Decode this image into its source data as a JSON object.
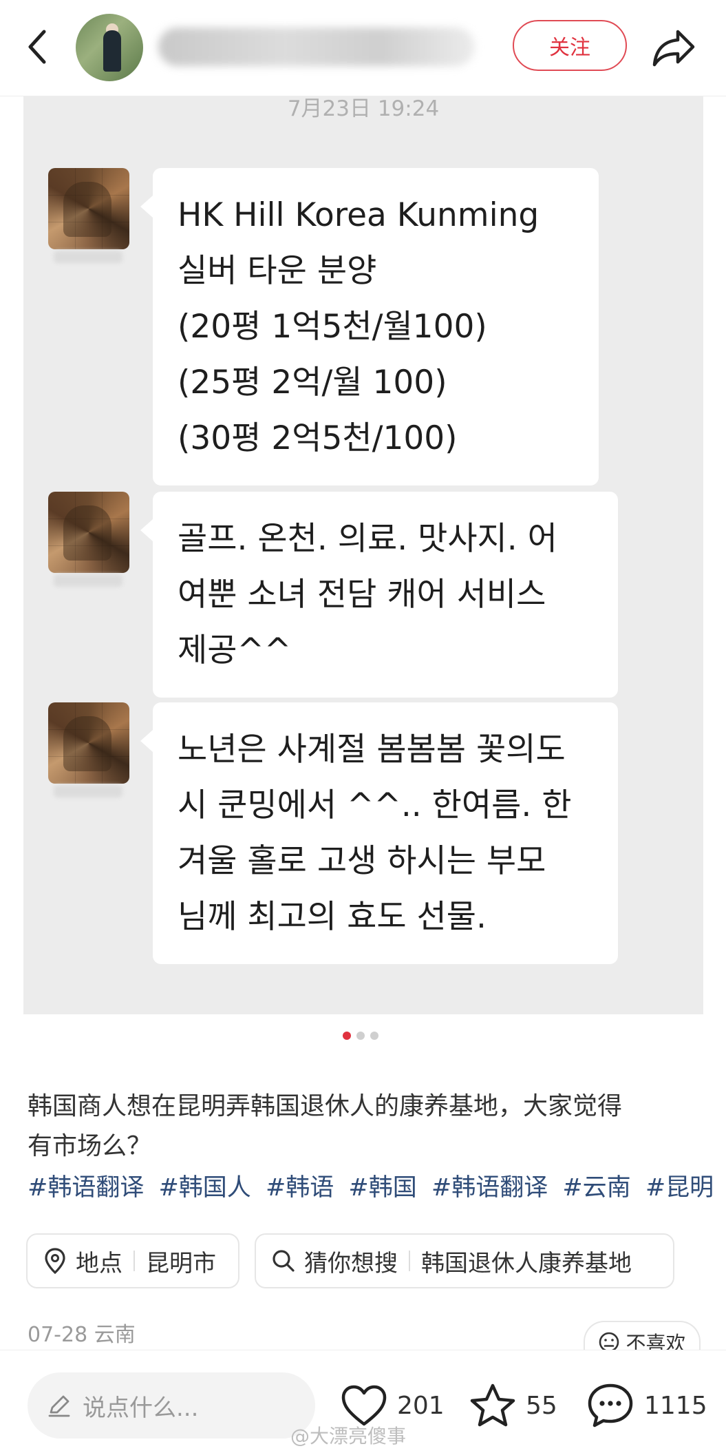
{
  "header": {
    "follow_label": "关注",
    "icons": [
      "back-icon",
      "share-icon"
    ]
  },
  "chat_image": {
    "timestamp": "7月23日 19:24",
    "messages": [
      {
        "lines": [
          "HK Hill  Korea   Kunming",
          "실버 타운 분양",
          "(20평 1억5천/월100)",
          "(25평 2억/월 100)",
          "(30평 2억5천/100)"
        ]
      },
      {
        "lines": [
          "골프. 온천. 의료. 맛사지. 어",
          "여뿐 소녀 전담 캐어 서비스",
          "제공^^"
        ]
      },
      {
        "lines": [
          "노년은 사계절 봄봄봄 꽃의도",
          "시 쿤밍에서 ^^.. 한여름. 한",
          "겨울 홀로 고생 하시는  부모",
          "님께 최고의 효도 선물."
        ]
      }
    ]
  },
  "post": {
    "text_line1": "韩国商人想在昆明弄韩国退休人的康养基地，大家觉得",
    "text_line2": "有市场么？",
    "tags": [
      "#韩语翻译",
      "#韩国人",
      "#韩语",
      "#韩国",
      "#韩语翻译",
      "#云南",
      "#昆明"
    ]
  },
  "chips": {
    "location_label": "地点",
    "location_value": "昆明市",
    "search_label": "猜你想搜",
    "search_value": "韩国退休人康养基地"
  },
  "meta": {
    "date_location": "07-28 云南",
    "dislike_label": "不喜欢"
  },
  "bottom": {
    "comment_placeholder": "说点什么...",
    "likes": "201",
    "favorites": "55",
    "comments": "1115",
    "watermark": "@大漂亮傻事"
  },
  "colors": {
    "accent": "#e0323f",
    "tag": "#2f4c78",
    "panel_bg": "#ececec"
  }
}
